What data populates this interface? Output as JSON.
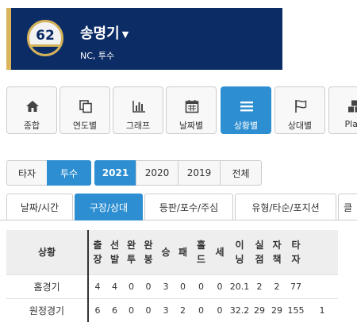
{
  "player": {
    "number": "62",
    "name": "송명기",
    "meta": "NC, 투수"
  },
  "nav": [
    {
      "label": "종합",
      "icon": "home-icon"
    },
    {
      "label": "연도별",
      "icon": "copy-icon"
    },
    {
      "label": "그래프",
      "icon": "bar-chart-icon"
    },
    {
      "label": "날짜별",
      "icon": "calendar-icon"
    },
    {
      "label": "상황별",
      "icon": "list-icon",
      "active": true
    },
    {
      "label": "상대별",
      "icon": "flag-icon"
    },
    {
      "label": "Play",
      "icon": "cubes-icon"
    }
  ],
  "role_filter": {
    "batter": "타자",
    "pitcher": "투수"
  },
  "season_filter": {
    "y2021": "2021",
    "y2020": "2020",
    "y2019": "2019",
    "all": "전체"
  },
  "tabs": [
    "날짜/시간",
    "구장/상대",
    "등판/포수/주심",
    "유형/타순/포지션",
    "클"
  ],
  "table": {
    "headers": [
      "상황",
      "출장",
      "선발",
      "완투",
      "완봉",
      "승",
      "패",
      "홀드",
      "세",
      "이닝",
      "실점",
      "자책",
      "타자",
      ""
    ],
    "rows": [
      [
        "홈경기",
        "4",
        "4",
        "0",
        "0",
        "3",
        "0",
        "0",
        "0",
        "20.1",
        "2",
        "2",
        "77",
        ""
      ],
      [
        "원정경기",
        "6",
        "6",
        "0",
        "0",
        "3",
        "2",
        "0",
        "0",
        "32.2",
        "29",
        "29",
        "155",
        "1"
      ]
    ]
  },
  "colors": {
    "navy": "#0c2c66",
    "gold": "#d4b25a",
    "accent": "#2d8ed1"
  }
}
